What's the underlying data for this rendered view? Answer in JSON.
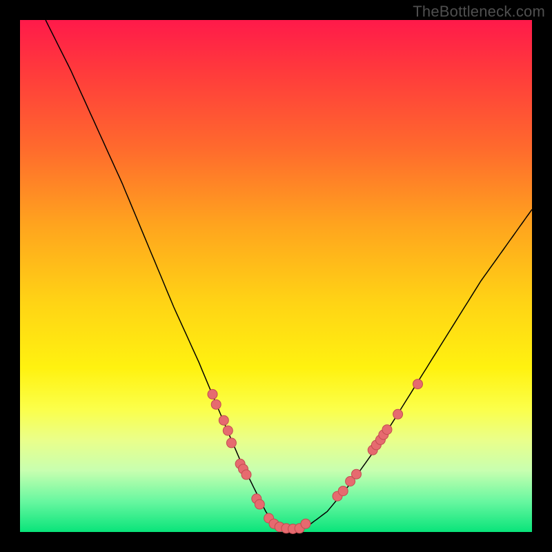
{
  "watermark": "TheBottleneck.com",
  "colors": {
    "frame_bg": "#000000",
    "gradient_top": "#ff1a4a",
    "gradient_bottom": "#09e47a",
    "curve_stroke": "#000000",
    "marker_fill": "#e66a6f",
    "marker_stroke": "#c24b50"
  },
  "chart_data": {
    "type": "line",
    "title": "",
    "xlabel": "",
    "ylabel": "",
    "xlim": [
      0,
      100
    ],
    "ylim": [
      0,
      100
    ],
    "grid": false,
    "legend": false,
    "series": [
      {
        "name": "bottleneck-curve",
        "x": [
          5,
          10,
          15,
          20,
          25,
          30,
          35,
          40,
          43,
          46,
          48,
          50,
          52,
          54,
          56,
          60,
          65,
          70,
          75,
          80,
          85,
          90,
          95,
          100
        ],
        "y": [
          100,
          90,
          79,
          68,
          56,
          44,
          33,
          21,
          14,
          8,
          4,
          1,
          0,
          0,
          1,
          4,
          10,
          17,
          25,
          33,
          41,
          49,
          56,
          63
        ]
      }
    ],
    "markers": [
      {
        "x": 37.6,
        "y": 26.9
      },
      {
        "x": 38.3,
        "y": 24.9
      },
      {
        "x": 39.8,
        "y": 21.8
      },
      {
        "x": 40.6,
        "y": 19.8
      },
      {
        "x": 41.3,
        "y": 17.4
      },
      {
        "x": 43.0,
        "y": 13.3
      },
      {
        "x": 43.6,
        "y": 12.3
      },
      {
        "x": 44.2,
        "y": 11.2
      },
      {
        "x": 46.2,
        "y": 6.5
      },
      {
        "x": 46.8,
        "y": 5.4
      },
      {
        "x": 48.6,
        "y": 2.7
      },
      {
        "x": 49.6,
        "y": 1.6
      },
      {
        "x": 50.7,
        "y": 1.0
      },
      {
        "x": 52.0,
        "y": 0.7
      },
      {
        "x": 53.3,
        "y": 0.6
      },
      {
        "x": 54.6,
        "y": 0.7
      },
      {
        "x": 55.8,
        "y": 1.6
      },
      {
        "x": 62.0,
        "y": 7.0
      },
      {
        "x": 63.1,
        "y": 8.0
      },
      {
        "x": 64.5,
        "y": 9.9
      },
      {
        "x": 65.7,
        "y": 11.3
      },
      {
        "x": 68.9,
        "y": 16.0
      },
      {
        "x": 69.6,
        "y": 17.0
      },
      {
        "x": 70.4,
        "y": 18.0
      },
      {
        "x": 71.0,
        "y": 19.0
      },
      {
        "x": 71.7,
        "y": 20.0
      },
      {
        "x": 73.8,
        "y": 23.0
      },
      {
        "x": 77.7,
        "y": 28.9
      }
    ]
  }
}
